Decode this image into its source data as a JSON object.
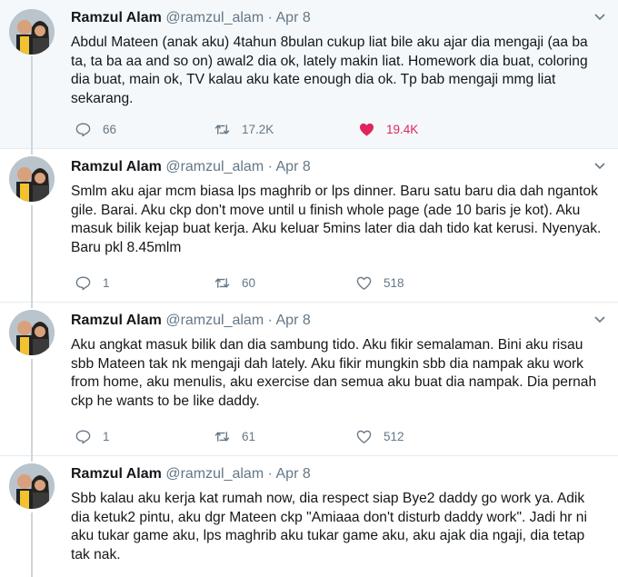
{
  "tweets": [
    {
      "name": "Ramzul Alam",
      "handle": "@ramzul_alam",
      "separator": "·",
      "date": "Apr 8",
      "text": "Abdul Mateen (anak aku) 4tahun 8bulan cukup liat bile aku ajar dia mengaji (aa ba ta, ta ba aa and so on) awal2 dia ok, lately makin liat. Homework dia buat, coloring dia buat, main ok, TV kalau aku kate enough dia ok. Tp bab mengaji mmg liat sekarang.",
      "replies": "66",
      "retweets": "17.2K",
      "likes": "19.4K"
    },
    {
      "name": "Ramzul Alam",
      "handle": "@ramzul_alam",
      "separator": "·",
      "date": "Apr 8",
      "text": "Smlm aku ajar mcm biasa lps maghrib or lps dinner. Baru satu baru dia dah ngantok gile. Barai. Aku ckp don't move until u finish whole page (ade 10 baris je kot). Aku masuk bilik kejap buat kerja. Aku keluar 5mins later dia dah tido kat kerusi. Nyenyak. Baru pkl 8.45mlm",
      "replies": "1",
      "retweets": "60",
      "likes": "518"
    },
    {
      "name": "Ramzul Alam",
      "handle": "@ramzul_alam",
      "separator": "·",
      "date": "Apr 8",
      "text": "Aku angkat masuk bilik dan dia sambung tido. Aku fikir semalaman. Bini aku risau sbb Mateen tak nk mengaji dah lately. Aku fikir mungkin sbb dia nampak aku work from home, aku menulis, aku exercise dan semua aku buat dia nampak. Dia pernah ckp he wants to be like daddy.",
      "replies": "1",
      "retweets": "61",
      "likes": "512"
    },
    {
      "name": "Ramzul Alam",
      "handle": "@ramzul_alam",
      "separator": "·",
      "date": "Apr 8",
      "text": "Sbb kalau aku kerja kat rumah now, dia respect siap Bye2 daddy go work ya. Adik dia ketuk2 pintu, aku dgr Mateen ckp \"Amiaaa don't disturb daddy work\". Jadi hr ni aku tukar game aku, lps maghrib aku tukar game aku, aku ajak dia ngaji, dia tetap tak nak."
    }
  ],
  "colors": {
    "text": "#14171a",
    "secondary": "#657786",
    "like": "#e0245e",
    "thread_line": "#ccd6dd"
  },
  "icons": [
    "reply-icon",
    "retweet-icon",
    "heart-icon",
    "heart-filled-icon",
    "chevron-down-icon"
  ]
}
